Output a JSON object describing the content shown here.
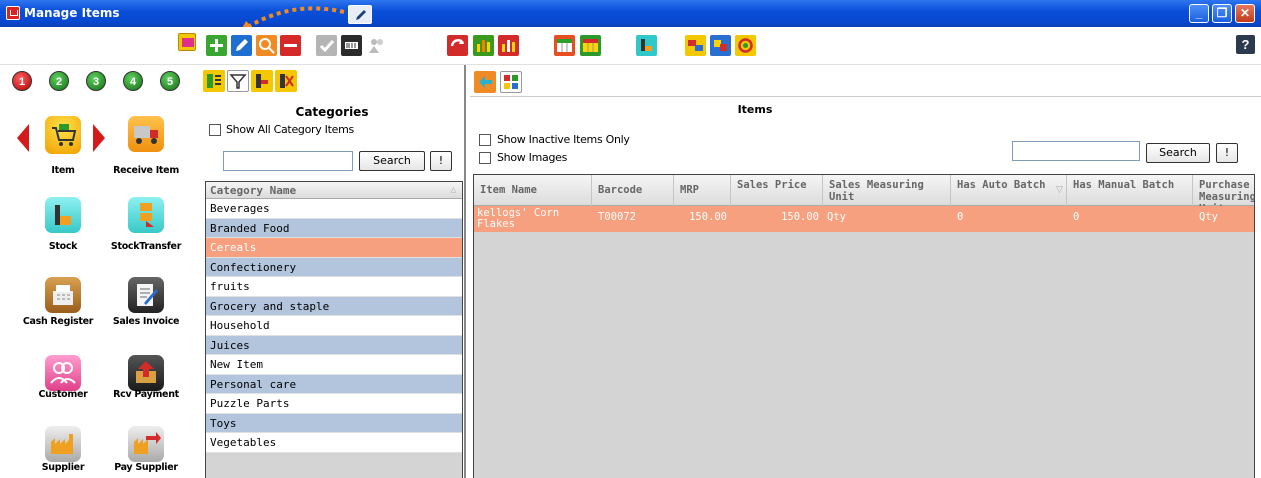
{
  "window": {
    "title": "Manage Items",
    "buttons": {
      "minimize": "_",
      "restore": "❐",
      "close": "✕"
    }
  },
  "toolbar": {
    "help_label": "?"
  },
  "leftnav": {
    "steps": [
      "1",
      "2",
      "3",
      "4",
      "5"
    ],
    "items": [
      {
        "label": "Item",
        "icon": "shopping-cart-icon"
      },
      {
        "label": "Receive Item",
        "icon": "truck-icon"
      },
      {
        "label": "Stock",
        "icon": "stock-icon"
      },
      {
        "label": "StockTransfer",
        "icon": "stock-transfer-icon"
      },
      {
        "label": "Cash Register",
        "icon": "cash-register-icon"
      },
      {
        "label": "Sales Invoice",
        "icon": "sales-invoice-icon"
      },
      {
        "label": "Customer",
        "icon": "customer-icon"
      },
      {
        "label": "Rcv Payment",
        "icon": "receive-payment-icon"
      },
      {
        "label": "Supplier",
        "icon": "supplier-icon"
      },
      {
        "label": "Pay Supplier",
        "icon": "pay-supplier-icon"
      }
    ]
  },
  "categories": {
    "title": "Categories",
    "show_all_label": "Show All Category Items",
    "search_value": "",
    "search_button": "Search",
    "clear_button": "!",
    "column_header": "Category Name",
    "rows": [
      "Beverages",
      "Branded Food",
      "Cereals",
      "Confectionery",
      "fruits",
      "Grocery and staple",
      "Household",
      "Juices",
      "New Item",
      "Personal care",
      "Puzzle Parts",
      "Toys",
      "Vegetables"
    ],
    "selected": "Cereals"
  },
  "items": {
    "title": "Items",
    "show_inactive_label": "Show Inactive Items Only",
    "show_images_label": "Show Images",
    "search_value": "",
    "search_button": "Search",
    "clear_button": "!",
    "columns": [
      "Item Name",
      "Barcode",
      "MRP",
      "Sales Price",
      "Sales Measuring Unit",
      "Has Auto Batch",
      "Has Manual Batch",
      "Purchase Measuring Unit"
    ],
    "rows": [
      {
        "name": "kellogs' Corn Flakes",
        "barcode": "T00072",
        "mrp": "150.00",
        "sales_price": "150.00",
        "sales_unit": "Qty",
        "auto_batch": "0",
        "manual_batch": "0",
        "purchase_unit": "Qty"
      }
    ]
  },
  "colors": {
    "titlebar": "#0a4fd8",
    "selected_row": "#f6a07f",
    "alt_row": "#b3c5dd"
  }
}
